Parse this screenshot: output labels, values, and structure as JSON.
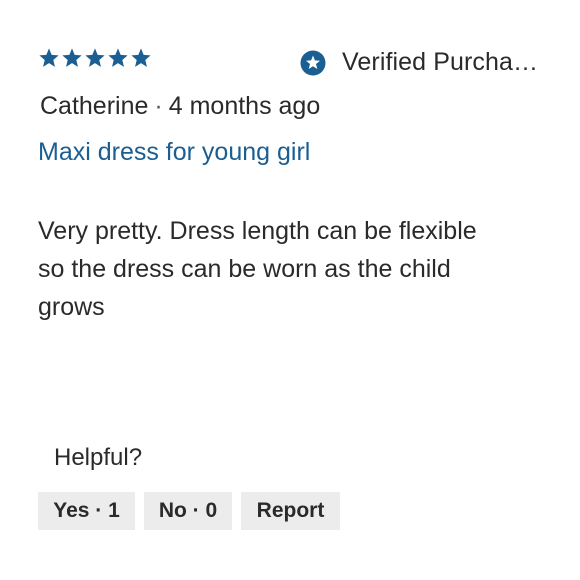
{
  "review": {
    "rating": 5,
    "rating_max": 5,
    "star_color": "#1a5e92",
    "verified_label": "Verified Purcha…",
    "verified_icon": "star-badge-icon",
    "author": "Catherine",
    "separator": "·",
    "time_ago": "4 months ago",
    "title": "Maxi dress for young girl",
    "body": "Very pretty. Dress length can be flexible so the dress can be worn as the child grows"
  },
  "feedback": {
    "prompt": "Helpful?",
    "yes_label": "Yes · 1",
    "no_label": "No · 0",
    "report_label": "Report"
  }
}
